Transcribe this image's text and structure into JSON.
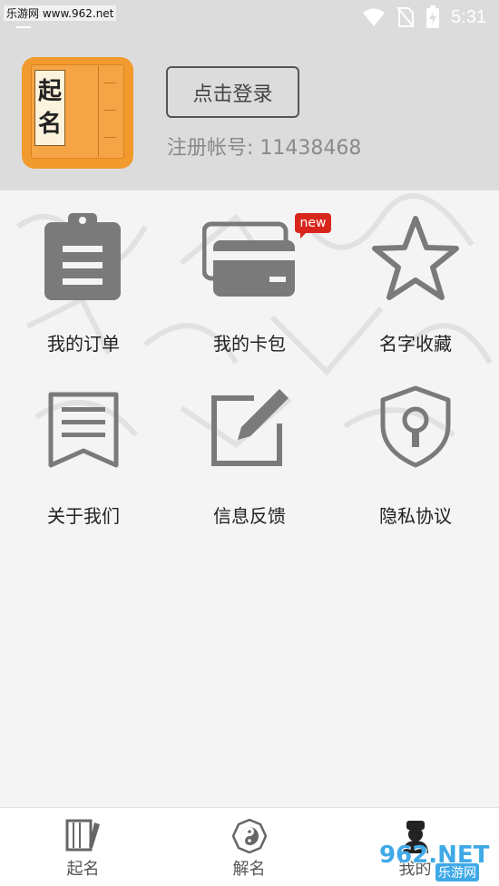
{
  "status_bar": {
    "watermark": "乐游网 www.962.net",
    "time": "5:31"
  },
  "profile": {
    "logo_chars": [
      "起",
      "名"
    ],
    "login_label": "点击登录",
    "account_label": "注册帐号: 11438468"
  },
  "menu": {
    "items": [
      {
        "label": "我的订单",
        "icon": "clipboard-icon"
      },
      {
        "label": "我的卡包",
        "icon": "wallet-card-icon",
        "badge": "new"
      },
      {
        "label": "名字收藏",
        "icon": "star-icon"
      },
      {
        "label": "关于我们",
        "icon": "document-icon"
      },
      {
        "label": "信息反馈",
        "icon": "edit-icon"
      },
      {
        "label": "隐私协议",
        "icon": "shield-lock-icon"
      }
    ]
  },
  "tabbar": {
    "tabs": [
      {
        "label": "起名",
        "icon": "book-pen-icon"
      },
      {
        "label": "解名",
        "icon": "bagua-icon"
      },
      {
        "label": "我的",
        "icon": "person-icon"
      }
    ]
  },
  "watermark_corner": {
    "big": "962.NET",
    "small": "乐游网"
  },
  "colors": {
    "header_bg": "#dcdcdc",
    "icon_gray": "#7a7a7a",
    "accent_orange": "#f29a2e",
    "badge_red": "#d9261c"
  }
}
